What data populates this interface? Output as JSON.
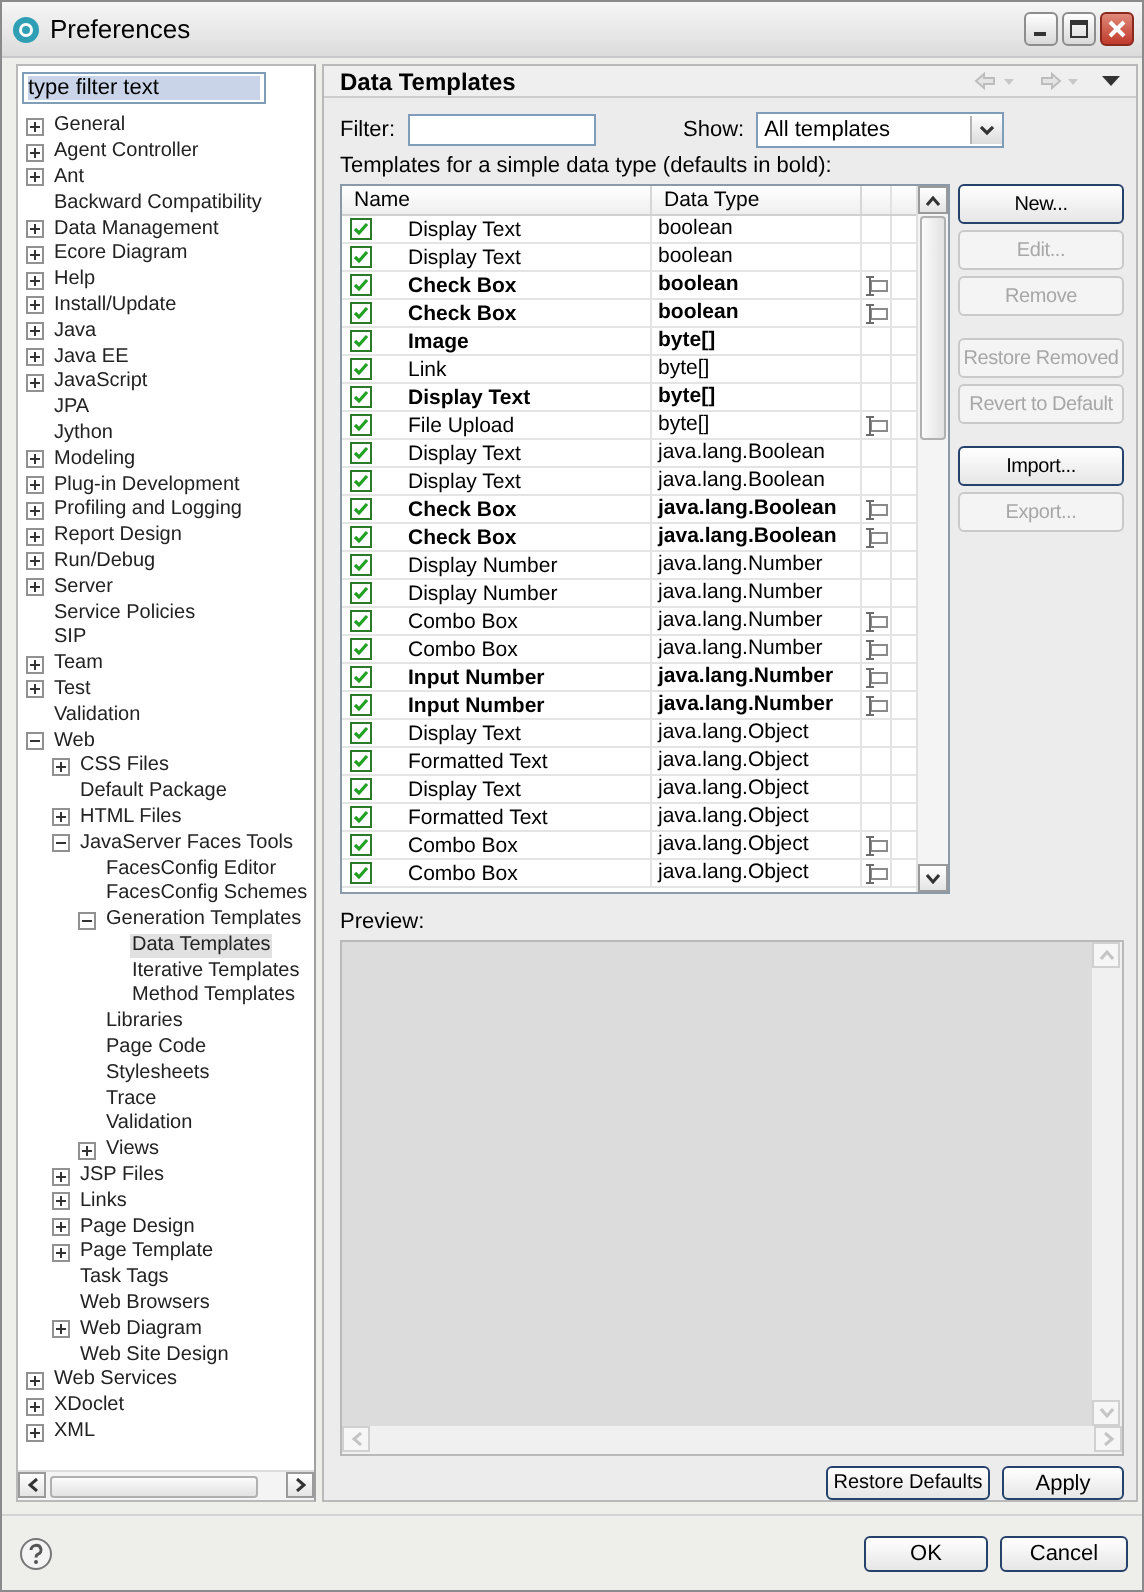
{
  "window": {
    "title": "Preferences"
  },
  "filter": {
    "placeholder": "type filter text"
  },
  "tree": [
    {
      "label": "General",
      "kind": "node",
      "expanded": false,
      "selected": false
    },
    {
      "label": "Agent Controller",
      "kind": "node",
      "expanded": false,
      "selected": false
    },
    {
      "label": "Ant",
      "kind": "node",
      "expanded": false,
      "selected": false
    },
    {
      "label": "Backward Compatibility",
      "kind": "leaf",
      "selected": false
    },
    {
      "label": "Data Management",
      "kind": "node",
      "expanded": false,
      "selected": false
    },
    {
      "label": "Ecore Diagram",
      "kind": "node",
      "expanded": false,
      "selected": false
    },
    {
      "label": "Help",
      "kind": "node",
      "expanded": false,
      "selected": false
    },
    {
      "label": "Install/Update",
      "kind": "node",
      "expanded": false,
      "selected": false
    },
    {
      "label": "Java",
      "kind": "node",
      "expanded": false,
      "selected": false
    },
    {
      "label": "Java EE",
      "kind": "node",
      "expanded": false,
      "selected": false
    },
    {
      "label": "JavaScript",
      "kind": "node",
      "expanded": false,
      "selected": false
    },
    {
      "label": "JPA",
      "kind": "leaf",
      "selected": false
    },
    {
      "label": "Jython",
      "kind": "leaf",
      "selected": false
    },
    {
      "label": "Modeling",
      "kind": "node",
      "expanded": false,
      "selected": false
    },
    {
      "label": "Plug-in Development",
      "kind": "node",
      "expanded": false,
      "selected": false
    },
    {
      "label": "Profiling and Logging",
      "kind": "node",
      "expanded": false,
      "selected": false
    },
    {
      "label": "Report Design",
      "kind": "node",
      "expanded": false,
      "selected": false
    },
    {
      "label": "Run/Debug",
      "kind": "node",
      "expanded": false,
      "selected": false
    },
    {
      "label": "Server",
      "kind": "node",
      "expanded": false,
      "selected": false
    },
    {
      "label": "Service Policies",
      "kind": "leaf",
      "selected": false
    },
    {
      "label": "SIP",
      "kind": "leaf",
      "selected": false
    },
    {
      "label": "Team",
      "kind": "node",
      "expanded": false,
      "selected": false
    },
    {
      "label": "Test",
      "kind": "node",
      "expanded": false,
      "selected": false
    },
    {
      "label": "Validation",
      "kind": "leaf",
      "selected": false
    },
    {
      "label": "Web",
      "kind": "node",
      "expanded": true,
      "selected": false,
      "children": [
        {
          "label": "CSS Files",
          "kind": "node",
          "expanded": false,
          "selected": false
        },
        {
          "label": "Default Package",
          "kind": "leaf",
          "selected": false
        },
        {
          "label": "HTML Files",
          "kind": "node",
          "expanded": false,
          "selected": false
        },
        {
          "label": "JavaServer Faces Tools",
          "kind": "node",
          "expanded": true,
          "selected": false,
          "children": [
            {
              "label": "FacesConfig Editor",
              "kind": "leaf",
              "selected": false
            },
            {
              "label": "FacesConfig Schemes",
              "kind": "leaf",
              "selected": false
            },
            {
              "label": "Generation Templates",
              "kind": "node",
              "expanded": true,
              "selected": false,
              "children": [
                {
                  "label": "Data Templates",
                  "kind": "leaf",
                  "selected": true
                },
                {
                  "label": "Iterative Templates",
                  "kind": "leaf",
                  "selected": false
                },
                {
                  "label": "Method Templates",
                  "kind": "leaf",
                  "selected": false
                }
              ]
            },
            {
              "label": "Libraries",
              "kind": "leaf",
              "selected": false
            },
            {
              "label": "Page Code",
              "kind": "leaf",
              "selected": false
            },
            {
              "label": "Stylesheets",
              "kind": "leaf",
              "selected": false
            },
            {
              "label": "Trace",
              "kind": "leaf",
              "selected": false
            },
            {
              "label": "Validation",
              "kind": "leaf",
              "selected": false
            },
            {
              "label": "Views",
              "kind": "node",
              "expanded": false,
              "selected": false
            }
          ]
        },
        {
          "label": "JSP Files",
          "kind": "node",
          "expanded": false,
          "selected": false
        },
        {
          "label": "Links",
          "kind": "node",
          "expanded": false,
          "selected": false
        },
        {
          "label": "Page Design",
          "kind": "node",
          "expanded": false,
          "selected": false
        },
        {
          "label": "Page Template",
          "kind": "node",
          "expanded": false,
          "selected": false
        },
        {
          "label": "Task Tags",
          "kind": "leaf",
          "selected": false
        },
        {
          "label": "Web Browsers",
          "kind": "leaf",
          "selected": false
        },
        {
          "label": "Web Diagram",
          "kind": "node",
          "expanded": false,
          "selected": false
        },
        {
          "label": "Web Site Design",
          "kind": "leaf",
          "selected": false
        }
      ]
    },
    {
      "label": "Web Services",
      "kind": "node",
      "expanded": false,
      "selected": false
    },
    {
      "label": "XDoclet",
      "kind": "node",
      "expanded": false,
      "selected": false
    },
    {
      "label": "XML",
      "kind": "node",
      "expanded": false,
      "selected": false
    }
  ],
  "page": {
    "title": "Data Templates",
    "filter_label": "Filter:",
    "show_label": "Show:",
    "show_value": "All templates",
    "table_caption": "Templates for a simple data type (defaults in bold):",
    "columns": [
      "Name",
      "Data Type"
    ],
    "rows": [
      {
        "checked": true,
        "name": "Display Text",
        "type": "boolean",
        "default": false,
        "editor_icon": false
      },
      {
        "checked": true,
        "name": "Display Text",
        "type": "boolean",
        "default": false,
        "editor_icon": false
      },
      {
        "checked": true,
        "name": "Check Box",
        "type": "boolean",
        "default": true,
        "editor_icon": true
      },
      {
        "checked": true,
        "name": "Check Box",
        "type": "boolean",
        "default": true,
        "editor_icon": true
      },
      {
        "checked": true,
        "name": "Image",
        "type": "byte[]",
        "default": true,
        "editor_icon": false
      },
      {
        "checked": true,
        "name": "Link",
        "type": "byte[]",
        "default": false,
        "editor_icon": false
      },
      {
        "checked": true,
        "name": "Display Text",
        "type": "byte[]",
        "default": true,
        "editor_icon": false
      },
      {
        "checked": true,
        "name": "File Upload",
        "type": "byte[]",
        "default": false,
        "editor_icon": true
      },
      {
        "checked": true,
        "name": "Display Text",
        "type": "java.lang.Boolean",
        "default": false,
        "editor_icon": false
      },
      {
        "checked": true,
        "name": "Display Text",
        "type": "java.lang.Boolean",
        "default": false,
        "editor_icon": false
      },
      {
        "checked": true,
        "name": "Check Box",
        "type": "java.lang.Boolean",
        "default": true,
        "editor_icon": true
      },
      {
        "checked": true,
        "name": "Check Box",
        "type": "java.lang.Boolean",
        "default": true,
        "editor_icon": true
      },
      {
        "checked": true,
        "name": "Display Number",
        "type": "java.lang.Number",
        "default": false,
        "editor_icon": false
      },
      {
        "checked": true,
        "name": "Display Number",
        "type": "java.lang.Number",
        "default": false,
        "editor_icon": false
      },
      {
        "checked": true,
        "name": "Combo Box",
        "type": "java.lang.Number",
        "default": false,
        "editor_icon": true
      },
      {
        "checked": true,
        "name": "Combo Box",
        "type": "java.lang.Number",
        "default": false,
        "editor_icon": true
      },
      {
        "checked": true,
        "name": "Input Number",
        "type": "java.lang.Number",
        "default": true,
        "editor_icon": true
      },
      {
        "checked": true,
        "name": "Input Number",
        "type": "java.lang.Number",
        "default": true,
        "editor_icon": true
      },
      {
        "checked": true,
        "name": "Display Text",
        "type": "java.lang.Object",
        "default": false,
        "editor_icon": false
      },
      {
        "checked": true,
        "name": "Formatted Text",
        "type": "java.lang.Object",
        "default": false,
        "editor_icon": false
      },
      {
        "checked": true,
        "name": "Display Text",
        "type": "java.lang.Object",
        "default": false,
        "editor_icon": false
      },
      {
        "checked": true,
        "name": "Formatted Text",
        "type": "java.lang.Object",
        "default": false,
        "editor_icon": false
      },
      {
        "checked": true,
        "name": "Combo Box",
        "type": "java.lang.Object",
        "default": false,
        "editor_icon": true
      },
      {
        "checked": true,
        "name": "Combo Box",
        "type": "java.lang.Object",
        "default": false,
        "editor_icon": true
      }
    ],
    "side_button_groups": [
      [
        {
          "label": "New...",
          "disabled": false
        },
        {
          "label": "Edit...",
          "disabled": true
        },
        {
          "label": "Remove",
          "disabled": true
        }
      ],
      [
        {
          "label": "Restore Removed",
          "disabled": true
        },
        {
          "label": "Revert to Default",
          "disabled": true
        }
      ],
      [
        {
          "label": "Import...",
          "disabled": false
        },
        {
          "label": "Export...",
          "disabled": true
        }
      ]
    ],
    "preview_label": "Preview:",
    "page_buttons": [
      "Restore Defaults",
      "Apply"
    ]
  },
  "dialog_buttons": [
    "OK",
    "Cancel"
  ]
}
